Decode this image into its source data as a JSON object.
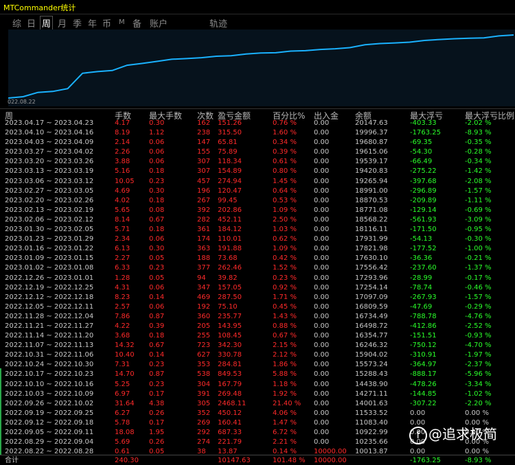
{
  "title": "MTCommander统计",
  "tabs": [
    "综",
    "日",
    "周",
    "月",
    "季",
    "年",
    "币",
    "M",
    "备",
    "账户",
    "轨迹"
  ],
  "active_tab": "周",
  "chart": {
    "start_label": "022.08.22",
    "line_color": "#1ab2ff",
    "balances": [
      10013.87,
      10235.66,
      10922.99,
      11083.4,
      11533.52,
      14001.63,
      14271.11,
      14438.9,
      15288.43,
      15573.24,
      15904.02,
      16246.32,
      16354.77,
      16498.72,
      16734.49,
      16809.59,
      17097.09,
      17254.14,
      17293.96,
      17556.42,
      17630.1,
      17821.98,
      17931.99,
      18116.11,
      18568.22,
      18771.08,
      18870.53,
      18991.0,
      19265.94,
      19420.83,
      19539.17,
      19615.06,
      19680.87,
      19996.37,
      20147.63
    ]
  },
  "columns": [
    "周",
    "手数",
    "最大手数",
    "次数",
    "盈亏金额",
    "百分比%",
    "出入金",
    "余额",
    "最大浮亏",
    "最大浮亏比例"
  ],
  "rows": [
    [
      "2023.04.17 ~ 2023.04.23",
      "4.17",
      "0.30",
      "162",
      "151.26",
      "0.76 %",
      "0.00",
      "20147.63",
      "-403.33",
      "-2.02 %"
    ],
    [
      "2023.04.10 ~ 2023.04.16",
      "8.19",
      "1.12",
      "238",
      "315.50",
      "1.60 %",
      "0.00",
      "19996.37",
      "-1763.25",
      "-8.93 %"
    ],
    [
      "2023.04.03 ~ 2023.04.09",
      "2.14",
      "0.06",
      "147",
      "65.81",
      "0.34 %",
      "0.00",
      "19680.87",
      "-69.35",
      "-0.35 %"
    ],
    [
      "2023.03.27 ~ 2023.04.02",
      "2.26",
      "0.06",
      "155",
      "75.89",
      "0.39 %",
      "0.00",
      "19615.06",
      "-54.30",
      "-0.28 %"
    ],
    [
      "2023.03.20 ~ 2023.03.26",
      "3.88",
      "0.06",
      "307",
      "118.34",
      "0.61 %",
      "0.00",
      "19539.17",
      "-66.49",
      "-0.34 %"
    ],
    [
      "2023.03.13 ~ 2023.03.19",
      "5.16",
      "0.18",
      "307",
      "154.89",
      "0.80 %",
      "0.00",
      "19420.83",
      "-275.22",
      "-1.42 %"
    ],
    [
      "2023.03.06 ~ 2023.03.12",
      "10.05",
      "0.23",
      "457",
      "274.94",
      "1.45 %",
      "0.00",
      "19265.94",
      "-397.68",
      "-2.08 %"
    ],
    [
      "2023.02.27 ~ 2023.03.05",
      "4.69",
      "0.30",
      "196",
      "120.47",
      "0.64 %",
      "0.00",
      "18991.00",
      "-296.89",
      "-1.57 %"
    ],
    [
      "2023.02.20 ~ 2023.02.26",
      "4.02",
      "0.18",
      "267",
      "99.45",
      "0.53 %",
      "0.00",
      "18870.53",
      "-209.89",
      "-1.11 %"
    ],
    [
      "2023.02.13 ~ 2023.02.19",
      "5.65",
      "0.08",
      "392",
      "202.86",
      "1.09 %",
      "0.00",
      "18771.08",
      "-129.14",
      "-0.69 %"
    ],
    [
      "2023.02.06 ~ 2023.02.12",
      "8.14",
      "0.67",
      "282",
      "452.11",
      "2.50 %",
      "0.00",
      "18568.22",
      "-561.93",
      "-3.09 %"
    ],
    [
      "2023.01.30 ~ 2023.02.05",
      "5.71",
      "0.18",
      "361",
      "184.12",
      "1.03 %",
      "0.00",
      "18116.11",
      "-171.50",
      "-0.95 %"
    ],
    [
      "2023.01.23 ~ 2023.01.29",
      "2.34",
      "0.06",
      "174",
      "110.01",
      "0.62 %",
      "0.00",
      "17931.99",
      "-54.13",
      "-0.30 %"
    ],
    [
      "2023.01.16 ~ 2023.01.22",
      "6.13",
      "0.30",
      "363",
      "191.88",
      "1.09 %",
      "0.00",
      "17821.98",
      "-177.52",
      "-1.00 %"
    ],
    [
      "2023.01.09 ~ 2023.01.15",
      "2.27",
      "0.05",
      "188",
      "73.68",
      "0.42 %",
      "0.00",
      "17630.10",
      "-36.36",
      "-0.21 %"
    ],
    [
      "2023.01.02 ~ 2023.01.08",
      "6.33",
      "0.23",
      "377",
      "262.46",
      "1.52 %",
      "0.00",
      "17556.42",
      "-237.60",
      "-1.37 %"
    ],
    [
      "2022.12.26 ~ 2023.01.01",
      "1.28",
      "0.05",
      "94",
      "39.82",
      "0.23 %",
      "0.00",
      "17293.96",
      "-28.99",
      "-0.17 %"
    ],
    [
      "2022.12.19 ~ 2022.12.25",
      "4.31",
      "0.06",
      "347",
      "157.05",
      "0.92 %",
      "0.00",
      "17254.14",
      "-78.74",
      "-0.46 %"
    ],
    [
      "2022.12.12 ~ 2022.12.18",
      "8.23",
      "0.14",
      "469",
      "287.50",
      "1.71 %",
      "0.00",
      "17097.09",
      "-267.93",
      "-1.57 %"
    ],
    [
      "2022.12.05 ~ 2022.12.11",
      "2.57",
      "0.06",
      "192",
      "75.10",
      "0.45 %",
      "0.00",
      "16809.59",
      "-47.69",
      "-0.29 %"
    ],
    [
      "2022.11.28 ~ 2022.12.04",
      "7.86",
      "0.87",
      "360",
      "235.77",
      "1.43 %",
      "0.00",
      "16734.49",
      "-788.78",
      "-4.76 %"
    ],
    [
      "2022.11.21 ~ 2022.11.27",
      "4.22",
      "0.39",
      "205",
      "143.95",
      "0.88 %",
      "0.00",
      "16498.72",
      "-412.86",
      "-2.52 %"
    ],
    [
      "2022.11.14 ~ 2022.11.20",
      "3.68",
      "0.18",
      "255",
      "108.45",
      "0.67 %",
      "0.00",
      "16354.77",
      "-151.51",
      "-0.93 %"
    ],
    [
      "2022.11.07 ~ 2022.11.13",
      "14.32",
      "0.67",
      "723",
      "342.30",
      "2.15 %",
      "0.00",
      "16246.32",
      "-750.12",
      "-4.70 %"
    ],
    [
      "2022.10.31 ~ 2022.11.06",
      "10.40",
      "0.14",
      "627",
      "330.78",
      "2.12 %",
      "0.00",
      "15904.02",
      "-310.91",
      "-1.97 %"
    ],
    [
      "2022.10.24 ~ 2022.10.30",
      "7.31",
      "0.23",
      "353",
      "284.81",
      "1.86 %",
      "0.00",
      "15573.24",
      "-364.97",
      "-2.37 %"
    ],
    [
      "2022.10.17 ~ 2022.10.23",
      "14.70",
      "0.87",
      "538",
      "849.53",
      "5.88 %",
      "0.00",
      "15288.43",
      "-888.17",
      "-5.96 %"
    ],
    [
      "2022.10.10 ~ 2022.10.16",
      "5.25",
      "0.23",
      "304",
      "167.79",
      "1.18 %",
      "0.00",
      "14438.90",
      "-478.26",
      "-3.34 %"
    ],
    [
      "2022.10.03 ~ 2022.10.09",
      "6.97",
      "0.17",
      "391",
      "269.48",
      "1.92 %",
      "0.00",
      "14271.11",
      "-144.85",
      "-1.02 %"
    ],
    [
      "2022.09.26 ~ 2022.10.02",
      "31.64",
      "4.38",
      "305",
      "2468.11",
      "21.40 %",
      "0.00",
      "14001.63",
      "-307.22",
      "-2.20 %"
    ],
    [
      "2022.09.19 ~ 2022.09.25",
      "6.27",
      "0.26",
      "352",
      "450.12",
      "4.06 %",
      "0.00",
      "11533.52",
      "0.00",
      "0.00 %"
    ],
    [
      "2022.09.12 ~ 2022.09.18",
      "5.78",
      "0.17",
      "269",
      "160.41",
      "1.47 %",
      "0.00",
      "11083.40",
      "0.00",
      "0.00 %"
    ],
    [
      "2022.09.05 ~ 2022.09.11",
      "18.08",
      "1.95",
      "292",
      "687.33",
      "6.72 %",
      "0.00",
      "10922.99",
      "0.00",
      "0.00 %"
    ],
    [
      "2022.08.29 ~ 2022.09.04",
      "5.69",
      "0.26",
      "274",
      "221.79",
      "2.21 %",
      "0.00",
      "10235.66",
      "0.00",
      "0.00 %"
    ],
    [
      "2022.08.22 ~ 2022.08.28",
      "0.61",
      "0.05",
      "38",
      "13.87",
      "0.14 %",
      "10000.00",
      "10013.87",
      "0.00",
      "0.00 %"
    ]
  ],
  "footer": [
    "合计",
    "240.30",
    "",
    "",
    "10147.63",
    "101.48 %",
    "10000.00",
    "",
    "-1763.25",
    "-8.93 %"
  ],
  "watermark": "@追求极简",
  "watermark_icon": "f"
}
